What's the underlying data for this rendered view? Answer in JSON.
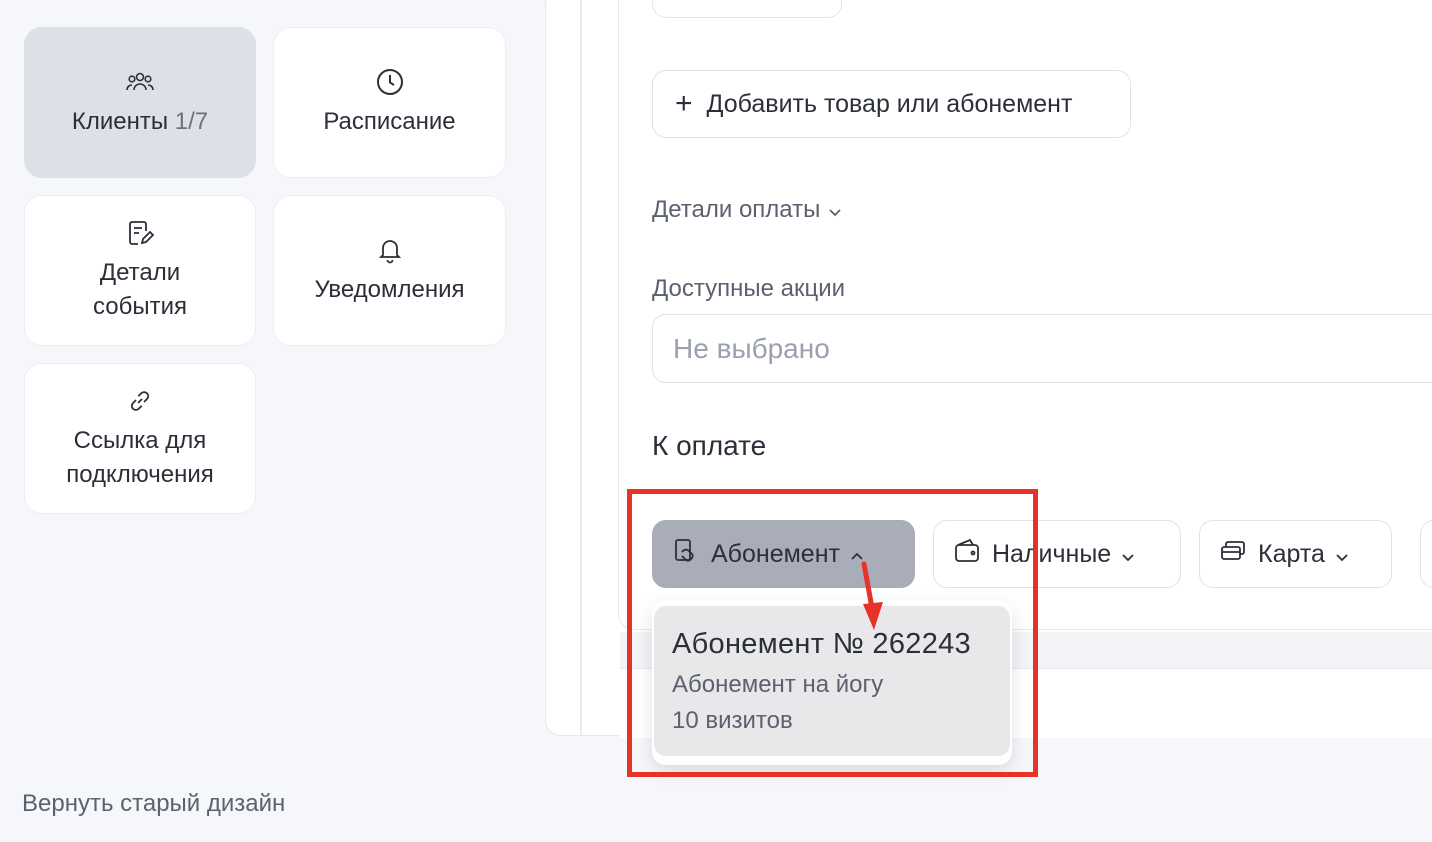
{
  "sidebar": {
    "clients_label": "Клиенты",
    "clients_count": "1/7",
    "schedule_label": "Расписание",
    "details_line1": "Детали",
    "details_line2": "события",
    "notifications_label": "Уведомления",
    "link_line1": "Ссылка для",
    "link_line2": "подключения"
  },
  "footer": {
    "old_design_label": "Вернуть старый дизайн"
  },
  "main": {
    "add_item_label": "Добавить товар или абонемент",
    "payment_details_label": "Детали оплаты",
    "promotions_label": "Доступные акции",
    "promotions_placeholder": "Не выбрано",
    "to_pay_label": "К оплате",
    "payment_methods": [
      {
        "label": "Абонемент",
        "selected": true
      },
      {
        "label": "Наличные",
        "selected": false
      },
      {
        "label": "Карта",
        "selected": false
      }
    ],
    "subscription_dropdown": {
      "items": [
        {
          "title": "Абонемент № 262243",
          "description": "Абонемент на йогу",
          "visits": "10 визитов"
        }
      ]
    }
  },
  "annotation": {
    "color": "#e5332a"
  }
}
